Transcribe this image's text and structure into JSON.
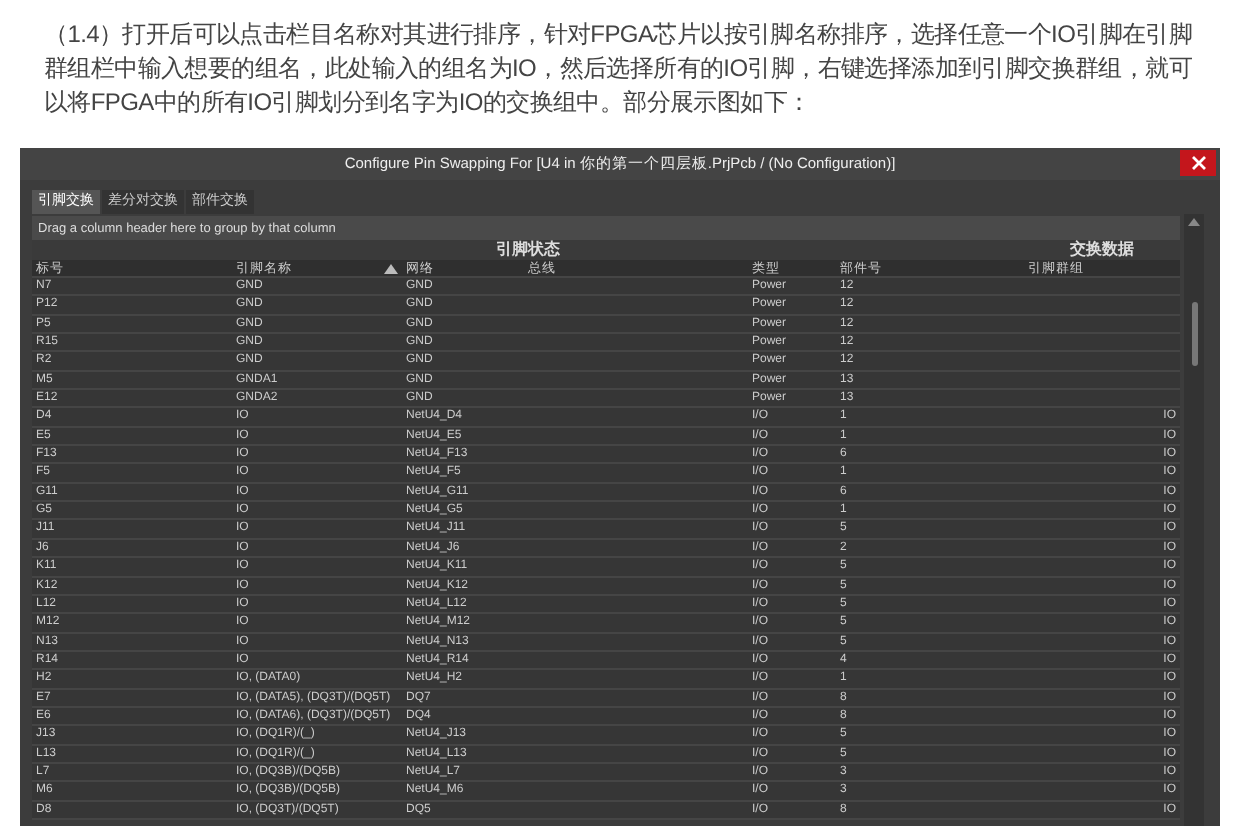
{
  "article": {
    "paragraph": "（1.4）打开后可以点击栏目名称对其进行排序，针对FPGA芯片以按引脚名称排序，选择任意一个IO引脚在引脚群组栏中输入想要的组名，此处输入的组名为IO，然后选择所有的IO引脚，右键选择添加到引脚交换群组，就可以将FPGA中的所有IO引脚划分到名字为IO的交换组中。部分展示图如下："
  },
  "window": {
    "title": "Configure Pin Swapping For [U4 in 你的第一个四层板.PrjPcb / (No Configuration)]"
  },
  "tabs": [
    {
      "label": "引脚交换",
      "selected": true
    },
    {
      "label": "差分对交换",
      "selected": false
    },
    {
      "label": "部件交换",
      "selected": false
    }
  ],
  "group_bar": {
    "hint": "Drag a column header here to group by that column"
  },
  "table": {
    "column_groups": [
      {
        "label": "引脚状态"
      },
      {
        "label": "交换数据"
      }
    ],
    "columns": [
      {
        "label": "标号",
        "sorted": false
      },
      {
        "label": "引脚名称",
        "sorted": true
      },
      {
        "label": "网络",
        "sorted": false
      },
      {
        "label": "总线",
        "sorted": false
      },
      {
        "label": "类型",
        "sorted": false
      },
      {
        "label": "部件号",
        "sorted": false
      },
      {
        "label": "引脚群组",
        "sorted": false
      }
    ],
    "rows": [
      [
        "N7",
        "GND",
        "GND",
        "",
        "Power",
        "12",
        ""
      ],
      [
        "P12",
        "GND",
        "GND",
        "",
        "Power",
        "12",
        ""
      ],
      [
        "P5",
        "GND",
        "GND",
        "",
        "Power",
        "12",
        ""
      ],
      [
        "R15",
        "GND",
        "GND",
        "",
        "Power",
        "12",
        ""
      ],
      [
        "R2",
        "GND",
        "GND",
        "",
        "Power",
        "12",
        ""
      ],
      [
        "M5",
        "GNDA1",
        "GND",
        "",
        "Power",
        "13",
        ""
      ],
      [
        "E12",
        "GNDA2",
        "GND",
        "",
        "Power",
        "13",
        ""
      ],
      [
        "D4",
        "IO",
        "NetU4_D4",
        "",
        "I/O",
        "1",
        "IO"
      ],
      [
        "E5",
        "IO",
        "NetU4_E5",
        "",
        "I/O",
        "1",
        "IO"
      ],
      [
        "F13",
        "IO",
        "NetU4_F13",
        "",
        "I/O",
        "6",
        "IO"
      ],
      [
        "F5",
        "IO",
        "NetU4_F5",
        "",
        "I/O",
        "1",
        "IO"
      ],
      [
        "G11",
        "IO",
        "NetU4_G11",
        "",
        "I/O",
        "6",
        "IO"
      ],
      [
        "G5",
        "IO",
        "NetU4_G5",
        "",
        "I/O",
        "1",
        "IO"
      ],
      [
        "J11",
        "IO",
        "NetU4_J11",
        "",
        "I/O",
        "5",
        "IO"
      ],
      [
        "J6",
        "IO",
        "NetU4_J6",
        "",
        "I/O",
        "2",
        "IO"
      ],
      [
        "K11",
        "IO",
        "NetU4_K11",
        "",
        "I/O",
        "5",
        "IO"
      ],
      [
        "K12",
        "IO",
        "NetU4_K12",
        "",
        "I/O",
        "5",
        "IO"
      ],
      [
        "L12",
        "IO",
        "NetU4_L12",
        "",
        "I/O",
        "5",
        "IO"
      ],
      [
        "M12",
        "IO",
        "NetU4_M12",
        "",
        "I/O",
        "5",
        "IO"
      ],
      [
        "N13",
        "IO",
        "NetU4_N13",
        "",
        "I/O",
        "5",
        "IO"
      ],
      [
        "R14",
        "IO",
        "NetU4_R14",
        "",
        "I/O",
        "4",
        "IO"
      ],
      [
        "H2",
        "IO, (DATA0)",
        "NetU4_H2",
        "",
        "I/O",
        "1",
        "IO"
      ],
      [
        "E7",
        "IO, (DATA5), (DQ3T)/(DQ5T)",
        "DQ7",
        "",
        "I/O",
        "8",
        "IO"
      ],
      [
        "E6",
        "IO, (DATA6), (DQ3T)/(DQ5T)",
        "DQ4",
        "",
        "I/O",
        "8",
        "IO"
      ],
      [
        "J13",
        "IO, (DQ1R)/(_)",
        "NetU4_J13",
        "",
        "I/O",
        "5",
        "IO"
      ],
      [
        "L13",
        "IO, (DQ1R)/(_)",
        "NetU4_L13",
        "",
        "I/O",
        "5",
        "IO"
      ],
      [
        "L7",
        "IO, (DQ3B)/(DQ5B)",
        "NetU4_L7",
        "",
        "I/O",
        "3",
        "IO"
      ],
      [
        "M6",
        "IO, (DQ3B)/(DQ5B)",
        "NetU4_M6",
        "",
        "I/O",
        "3",
        "IO"
      ],
      [
        "D8",
        "IO, (DQ3T)/(DQ5T)",
        "DQ5",
        "",
        "I/O",
        "8",
        "IO"
      ]
    ]
  }
}
